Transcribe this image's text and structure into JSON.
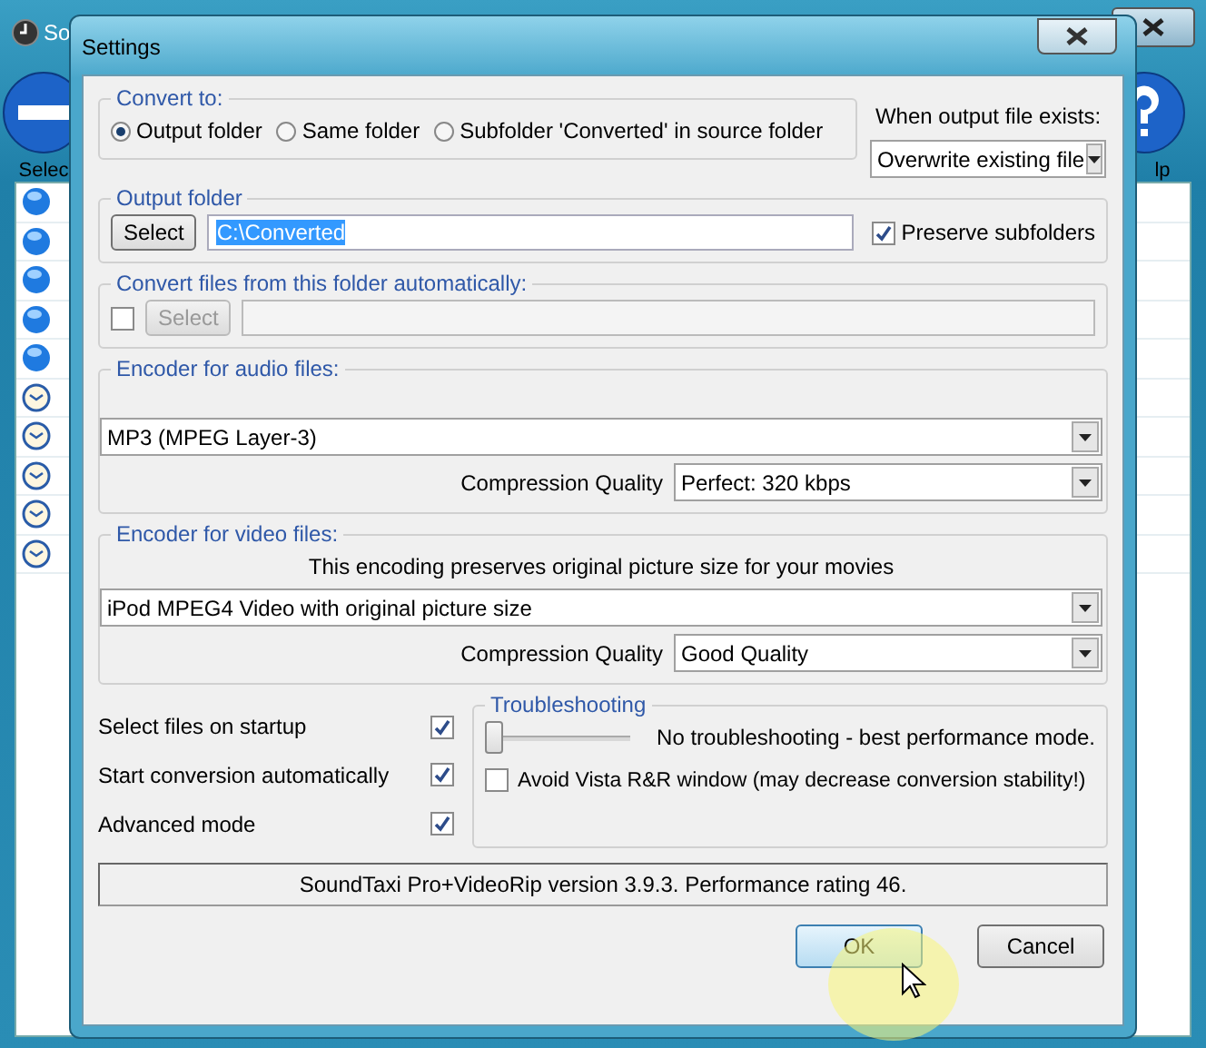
{
  "app_window": {
    "title": "So",
    "toolbar": [
      {
        "kind": "remove",
        "label": "Selec"
      },
      {
        "kind": "help",
        "label": "lp"
      }
    ],
    "list": [
      {
        "kind": "done"
      },
      {
        "kind": "done"
      },
      {
        "kind": "done"
      },
      {
        "kind": "done"
      },
      {
        "kind": "done"
      },
      {
        "kind": "waiting"
      },
      {
        "kind": "waiting"
      },
      {
        "kind": "waiting"
      },
      {
        "kind": "waiting"
      },
      {
        "kind": "waiting"
      }
    ]
  },
  "dialog": {
    "title": "Settings",
    "convert_to": {
      "legend": "Convert to:",
      "options": [
        {
          "label": "Output folder",
          "selected": true
        },
        {
          "label": "Same folder",
          "selected": false
        },
        {
          "label": "Subfolder 'Converted' in source folder",
          "selected": false
        }
      ]
    },
    "when_exists": {
      "label": "When output file exists:",
      "value": "Overwrite existing file"
    },
    "output_folder": {
      "legend": "Output folder",
      "button": "Select",
      "value": "C:\\Converted",
      "preserve": {
        "label": "Preserve subfolders",
        "checked": true
      }
    },
    "auto_folder": {
      "legend": "Convert files from this folder automatically:",
      "checked": false,
      "button": "Select",
      "disabled": true
    },
    "audio": {
      "legend": "Encoder for audio files:",
      "encoder": "MP3 (MPEG Layer-3)",
      "quality_label": "Compression Quality",
      "quality": "Perfect: 320 kbps"
    },
    "video": {
      "legend": "Encoder for video files:",
      "note": "This encoding preserves original picture size for your movies",
      "encoder": "iPod MPEG4 Video with original picture size",
      "quality_label": "Compression Quality",
      "quality": "Good Quality"
    },
    "options": [
      {
        "label": "Select files on startup",
        "checked": true
      },
      {
        "label": "Start conversion automatically",
        "checked": true
      },
      {
        "label": "Advanced mode",
        "checked": true
      }
    ],
    "troubleshooting": {
      "legend": "Troubleshooting",
      "level": 0,
      "reading": "No troubleshooting - best performance mode.",
      "avoid": {
        "label": "Avoid Vista R&R window (may decrease conversion stability!)",
        "checked": false
      }
    },
    "status": "SoundTaxi Pro+VideoRip version 3.9.3. Performance rating 46.",
    "buttons": [
      {
        "label": "OK",
        "default": true
      },
      {
        "label": "Cancel",
        "default": false
      }
    ]
  }
}
